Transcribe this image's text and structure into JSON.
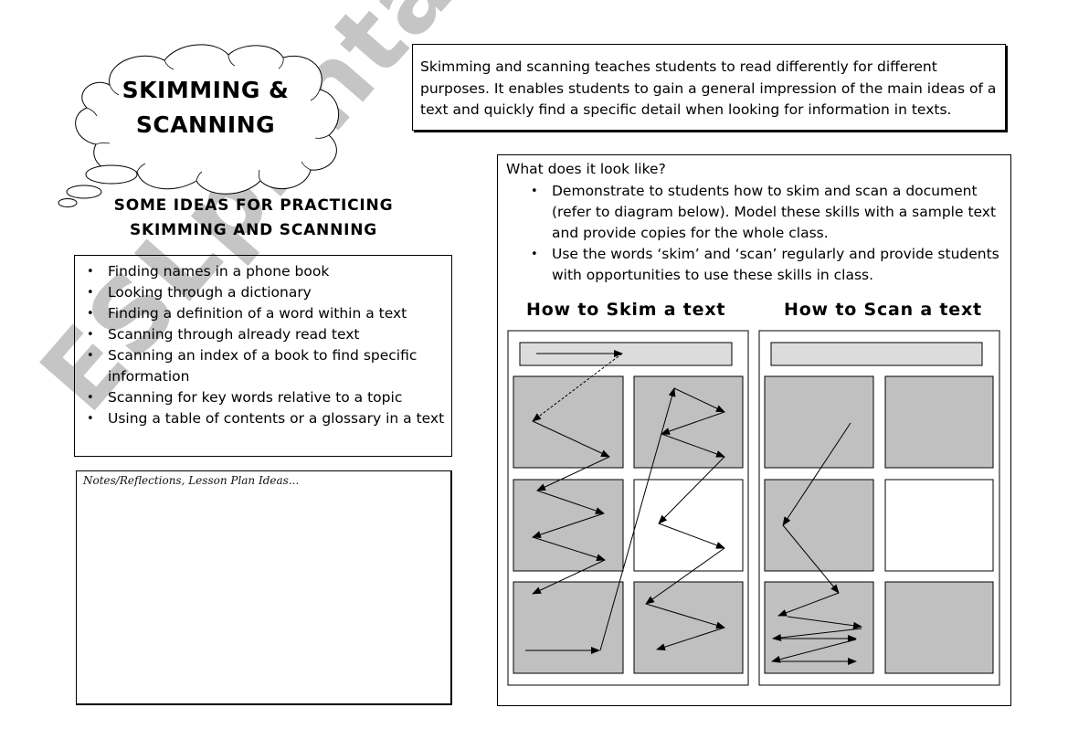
{
  "title": {
    "line1": "SKIMMING &",
    "line2": "SCANNING"
  },
  "intro": {
    "text": "Skimming and scanning teaches students to read differently for different purposes. It enables students to gain a general impression of the main ideas of a text and quickly find a specific detail when looking for information in texts."
  },
  "ideas": {
    "heading_line1": "SOME IDEAS FOR PRACTICING",
    "heading_line2": "SKIMMING AND SCANNING",
    "items": [
      "Finding names in a phone book",
      "Looking through a dictionary",
      "Finding a definition of a word within a text",
      "Scanning through already read text",
      "Scanning an index of a book to find specific information",
      "Scanning for key words relative to a topic",
      "Using a table of contents or a glossary in a text"
    ]
  },
  "notes": {
    "label": "Notes/Reflections, Lesson Plan Ideas..."
  },
  "look": {
    "heading": "What does it look like?",
    "items": [
      "Demonstrate to students how to skim and scan a document (refer to diagram below). Model these skills with a sample text and provide copies for the whole class.",
      "Use the words ‘skim’ and ‘scan’ regularly and provide students with opportunities to use these skills in class."
    ]
  },
  "diagrams": {
    "skim_title": "How to Skim a text",
    "scan_title": "How to Scan a text",
    "colors": {
      "header_bar": "#dcdcdc",
      "panel": "#c0c0c0",
      "panel_blank": "#ffffff"
    }
  },
  "watermark": {
    "text": "ESLprintables.com"
  },
  "icons": {
    "bullet": "•"
  }
}
